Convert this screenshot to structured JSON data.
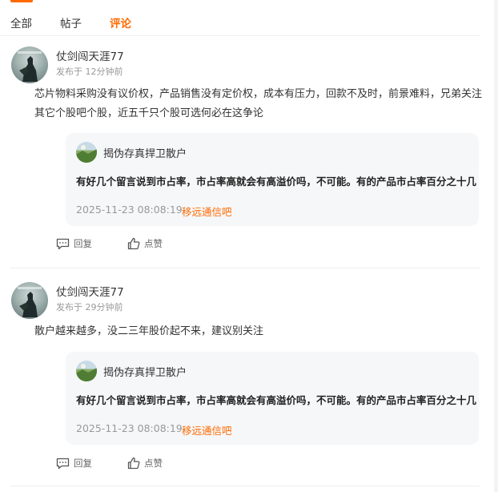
{
  "tabs": [
    {
      "label": "全部",
      "active": false
    },
    {
      "label": "帖子",
      "active": false
    },
    {
      "label": "评论",
      "active": true
    }
  ],
  "accent_color": "#ff6a00",
  "comments": [
    {
      "username": "仗剑闯天涯77",
      "time": "发布于 12分钟前",
      "text": "芯片物料采购没有议价权，产品销售没有定价权，成本有压力，回款不及时，前景难料，兄弟关注其它个股吧个股，近五千只个股可选何必在这争论",
      "quote": {
        "username": "揭伪存真捍卫散户",
        "text": "有好几个留言说到市占率，市占率高就会有高溢价吗，不可能。有的产品市占率百分之十几",
        "date": "2025-11-23 08:08:19",
        "source": "移远通信吧"
      },
      "reply_label": "回复",
      "like_label": "点赞"
    },
    {
      "username": "仗剑闯天涯77",
      "time": "发布于 29分钟前",
      "text": "散户越来越多，没二三年股价起不来，建议别关注",
      "quote": {
        "username": "揭伪存真捍卫散户",
        "text": "有好几个留言说到市占率，市占率高就会有高溢价吗，不可能。有的产品市占率百分之十几",
        "date": "2025-11-23 08:08:19",
        "source": "移远通信吧"
      },
      "reply_label": "回复",
      "like_label": "点赞"
    }
  ],
  "icons": {
    "reply": "comment-bubble-icon",
    "like": "thumbs-up-icon"
  }
}
